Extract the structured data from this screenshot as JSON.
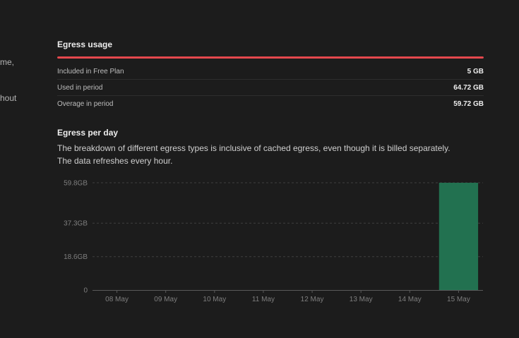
{
  "left_text": {
    "line1": "me,",
    "line2": "hout"
  },
  "egress_usage": {
    "title": "Egress usage",
    "bar_fill_percent": 100,
    "bar_color": "#e5484d",
    "rows": [
      {
        "label": "Included in Free Plan",
        "value": "5 GB"
      },
      {
        "label": "Used in period",
        "value": "64.72 GB"
      },
      {
        "label": "Overage in period",
        "value": "59.72 GB"
      }
    ]
  },
  "egress_per_day": {
    "title": "Egress per day",
    "description_line1": "The breakdown of different egress types is inclusive of cached egress, even though it is billed separately.",
    "description_line2": "The data refreshes every hour."
  },
  "chart_data": {
    "type": "bar",
    "categories": [
      "08 May",
      "09 May",
      "10 May",
      "11 May",
      "12 May",
      "13 May",
      "14 May",
      "15 May"
    ],
    "values": [
      0,
      0,
      0,
      0,
      0,
      0,
      0,
      59.8
    ],
    "y_ticks": [
      "0",
      "18.6GB",
      "37.3GB",
      "59.8GB"
    ],
    "y_tick_values": [
      0,
      18.6,
      37.3,
      59.8
    ],
    "ylim": [
      0,
      59.8
    ],
    "bar_color": "#227150",
    "grid": true,
    "grid_style": "dashed",
    "title": "",
    "xlabel": "",
    "ylabel": ""
  }
}
